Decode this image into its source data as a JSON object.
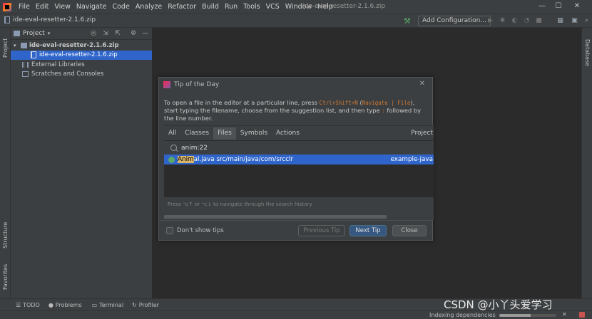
{
  "menu": [
    "File",
    "Edit",
    "View",
    "Navigate",
    "Code",
    "Analyze",
    "Refactor",
    "Build",
    "Run",
    "Tools",
    "VCS",
    "Window",
    "Help"
  ],
  "window_title": "ide-eval-resetter-2.1.6.zip",
  "window_controls": {
    "minimize": "—",
    "maximize": "☐",
    "close": "✕"
  },
  "navbar": {
    "breadcrumb": "ide-eval-resetter-2.1.6.zip",
    "add_configuration": "Add Configuration..."
  },
  "left_stripe": {
    "project_tab": "Project",
    "structure_tab": "Structure",
    "favorites_tab": "Favorites"
  },
  "right_stripe": {
    "database_tab": "Database"
  },
  "project_panel": {
    "title": "Project",
    "tree": [
      {
        "label": "ide-eval-resetter-2.1.6.zip",
        "bold": true
      },
      {
        "label": "ide-eval-resetter-2.1.6.zip",
        "selected": true
      },
      {
        "label": "External Libraries"
      },
      {
        "label": "Scratches and Consoles"
      }
    ]
  },
  "dialog": {
    "title": "Tip of the Day",
    "tip_prefix": "To open a file in the editor at a particular line, press ",
    "tip_shortcut": "Ctrl+Shift+N",
    "tip_paren_open": " (",
    "tip_action": "Navigate | File",
    "tip_middle": "), start typing the filename, choose from the suggestion list, and then type ",
    "tip_colon": ":",
    "tip_suffix": " followed by the line number.",
    "tabs": [
      "All",
      "Classes",
      "Files",
      "Symbols",
      "Actions"
    ],
    "active_tab": "Files",
    "scope_tab": "Project",
    "search_value": "anim:22",
    "result": {
      "highlight": "Anim",
      "rest": "al.java src/main/java/com/srcclr",
      "module": "example-java"
    },
    "hint": "Press ⌥↑ or ⌥↓ to navigate through the search history",
    "dont_show_label": "Don't show tips",
    "previous_tip": "Previous Tip",
    "next_tip": "Next Tip",
    "close": "Close"
  },
  "bottom_bar": [
    "TODO",
    "Problems",
    "Terminal",
    "Profiler"
  ],
  "status": {
    "indexing": "Indexing dependencies",
    "indexing_progress": 0.55
  },
  "watermark": "CSDN @小丫头爱学习"
}
